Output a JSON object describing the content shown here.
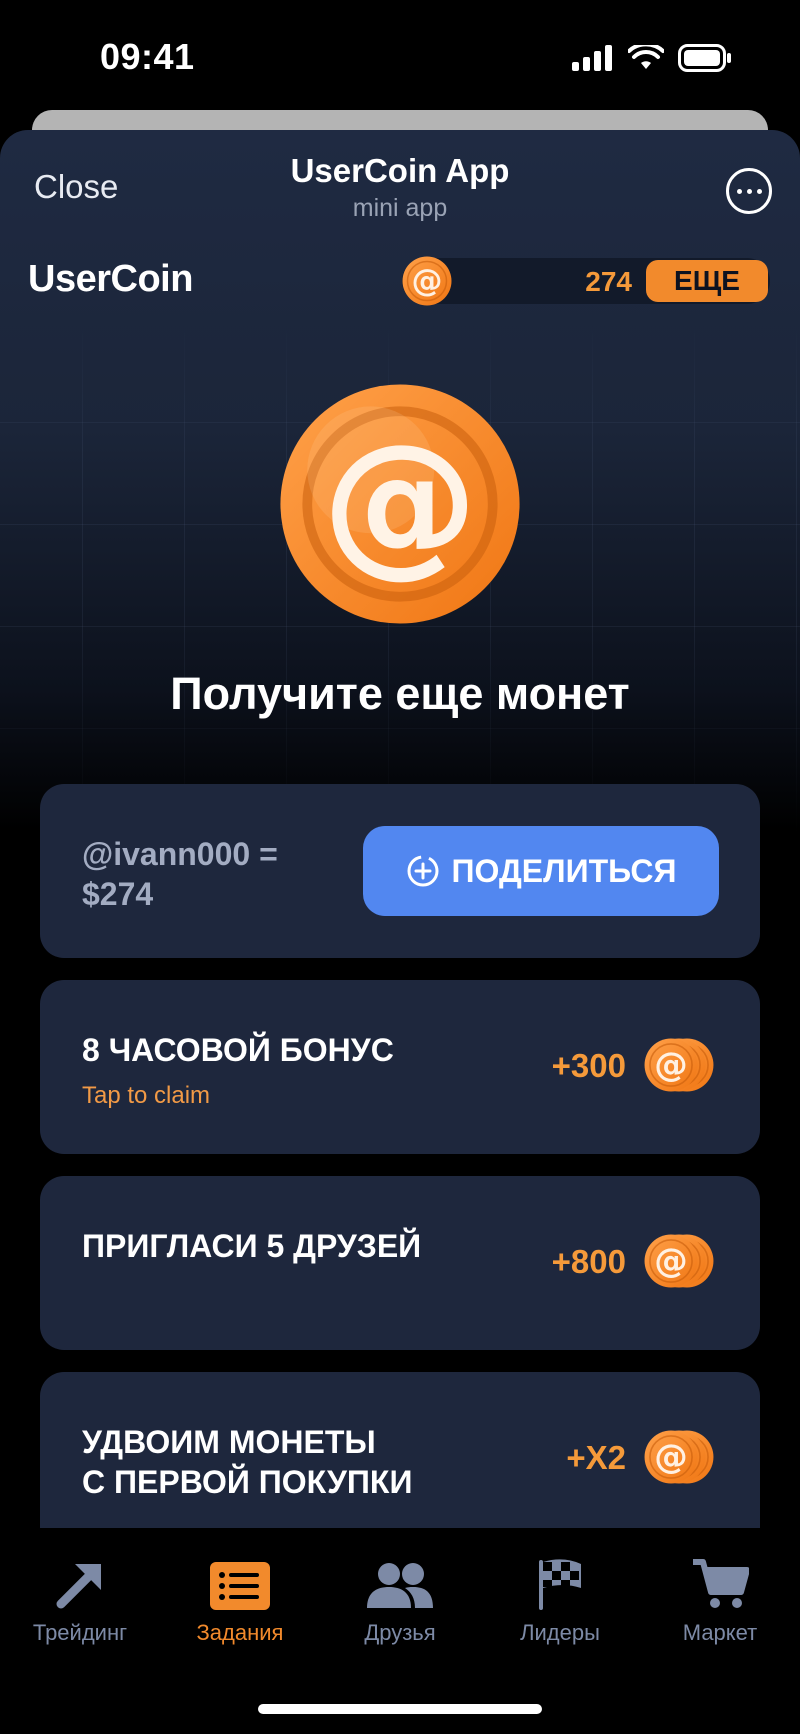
{
  "status": {
    "time": "09:41"
  },
  "header": {
    "close_label": "Close",
    "title": "UserCoin App",
    "subtitle": "mini app"
  },
  "top": {
    "brand": "UserCoin",
    "balance": "274",
    "more_label": "ЕЩЕ"
  },
  "hero": {
    "title": "Получите еще монет"
  },
  "share": {
    "text": "@ivann000 =\n$274",
    "button_label": "ПОДЕЛИТЬСЯ"
  },
  "tasks": [
    {
      "title": "8 ЧАСОВОЙ БОНУС",
      "subtitle": "Tap to claim",
      "reward": "+300"
    },
    {
      "title": "ПРИГЛАСИ 5 ДРУЗЕЙ",
      "reward": "+800"
    },
    {
      "title_line1": "УДВОИМ МОНЕТЫ",
      "title_line2": "С ПЕРВОЙ ПОКУПКИ",
      "reward": "+X2"
    }
  ],
  "tabbar": [
    {
      "label": "Трейдинг",
      "icon": "trend-arrow-icon"
    },
    {
      "label": "Задания",
      "icon": "task-list-icon",
      "active": true
    },
    {
      "label": "Друзья",
      "icon": "friends-icon"
    },
    {
      "label": "Лидеры",
      "icon": "checkered-flag-icon"
    },
    {
      "label": "Маркет",
      "icon": "cart-icon"
    }
  ],
  "colors": {
    "accent": "#f28a2c",
    "share_button": "#5287f0",
    "card": "#1e273d",
    "inactive_tab": "#7d8aa6"
  }
}
